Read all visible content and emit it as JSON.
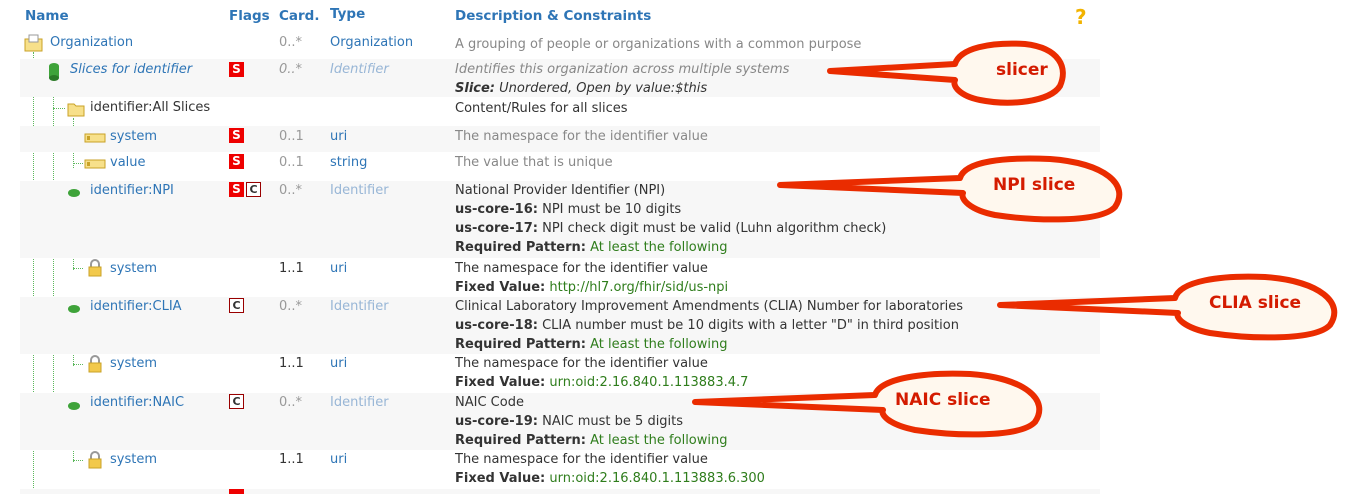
{
  "header": {
    "name": "Name",
    "flags": "Flags",
    "card": "Card.",
    "type": "Type",
    "desc": "Description & Constraints",
    "help": "?"
  },
  "rows": [
    {
      "name": "Organization",
      "card": "0..*",
      "type": "Organization",
      "desc": [
        "A grouping of people or organizations with a common purpose"
      ]
    },
    {
      "name": "Slices for identifier",
      "flag_s": "S",
      "card": "0..*",
      "type": "Identifier",
      "desc": [
        "Identifies this organization across multiple systems"
      ],
      "slice_label": "Slice:",
      "slice_text": "Unordered, Open by value:$this"
    },
    {
      "name": "identifier:All Slices",
      "desc": [
        "Content/Rules for all slices"
      ]
    },
    {
      "name": "system",
      "flag_s": "S",
      "card": "0..1",
      "type": "uri",
      "desc": [
        "The namespace for the identifier value"
      ]
    },
    {
      "name": "value",
      "flag_s": "S",
      "card": "0..1",
      "type": "string",
      "desc": [
        "The value that is unique"
      ]
    },
    {
      "name": "identifier:NPI",
      "flag_s": "S",
      "flag_c": "C",
      "card": "0..*",
      "type": "Identifier",
      "desc_title": "National Provider Identifier (NPI)",
      "c1_label": "us-core-16:",
      "c1_text": "NPI must be 10 digits",
      "c2_label": "us-core-17:",
      "c2_text": "NPI check digit must be valid (Luhn algorithm check)",
      "rp_label": "Required Pattern:",
      "rp_text": "At least the following"
    },
    {
      "name": "system",
      "card": "1..1",
      "type": "uri",
      "desc_title": "The namespace for the identifier value",
      "fv_label": "Fixed Value:",
      "fv_text": "http://hl7.org/fhir/sid/us-npi"
    },
    {
      "name": "identifier:CLIA",
      "flag_c": "C",
      "card": "0..*",
      "type": "Identifier",
      "desc_title": "Clinical Laboratory Improvement Amendments (CLIA) Number for laboratories",
      "c1_label": "us-core-18:",
      "c1_text": "CLIA number must be 10 digits with a letter \"D\" in third position",
      "rp_label": "Required Pattern:",
      "rp_text": "At least the following"
    },
    {
      "name": "system",
      "card": "1..1",
      "type": "uri",
      "desc_title": "The namespace for the identifier value",
      "fv_label": "Fixed Value:",
      "fv_text": "urn:oid:2.16.840.1.113883.4.7"
    },
    {
      "name": "identifier:NAIC",
      "flag_c": "C",
      "card": "0..*",
      "type": "Identifier",
      "desc_title": "NAIC Code",
      "c1_label": "us-core-19:",
      "c1_text": "NAIC must be 5 digits",
      "rp_label": "Required Pattern:",
      "rp_text": "At least the following"
    },
    {
      "name": "system",
      "card": "1..1",
      "type": "uri",
      "desc_title": "The namespace for the identifier value",
      "fv_label": "Fixed Value:",
      "fv_text": "urn:oid:2.16.840.1.113883.6.300"
    }
  ],
  "callouts": {
    "slicer": "slicer",
    "npi": "NPI slice",
    "clia": "CLIA slice",
    "naic": "NAIC slice"
  },
  "colors": {
    "link": "#2e75b6",
    "flag_s": "#ee0000",
    "callout": "#d41b00",
    "pattern": "#2f7d1c"
  }
}
